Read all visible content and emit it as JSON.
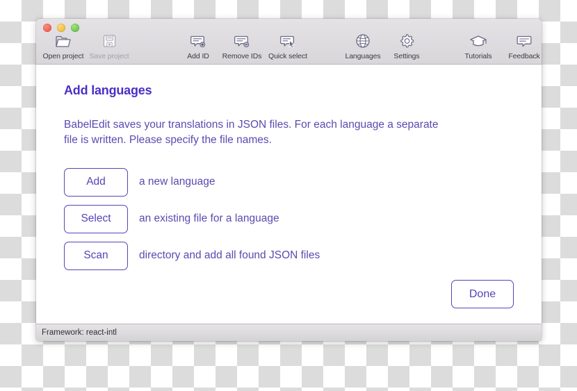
{
  "window": {
    "traffic_lights": [
      "close",
      "minimize",
      "zoom"
    ]
  },
  "toolbar": {
    "groups": [
      {
        "name": "file",
        "items": [
          {
            "label": "Open project",
            "icon": "folder-open-icon",
            "disabled": false
          },
          {
            "label": "Save project",
            "icon": "floppy-disk-icon",
            "disabled": true
          }
        ]
      },
      {
        "name": "ids",
        "items": [
          {
            "label": "Add ID",
            "icon": "speech-bubble-plus-icon",
            "disabled": false
          },
          {
            "label": "Remove IDs",
            "icon": "speech-bubble-minus-icon",
            "disabled": false
          },
          {
            "label": "Quick select",
            "icon": "speech-bubble-cursor-icon",
            "disabled": false
          }
        ]
      },
      {
        "name": "config",
        "items": [
          {
            "label": "Languages",
            "icon": "globe-icon",
            "disabled": false
          },
          {
            "label": "Settings",
            "icon": "gear-icon",
            "disabled": false
          }
        ]
      },
      {
        "name": "help",
        "items": [
          {
            "label": "Tutorials",
            "icon": "graduation-cap-icon",
            "disabled": false
          },
          {
            "label": "Feedback",
            "icon": "speech-bubble-icon",
            "disabled": false
          }
        ]
      }
    ]
  },
  "main": {
    "title": "Add languages",
    "intro": "BabelEdit saves your translations in JSON files. For each language a separate file is written. Please specify the file names.",
    "actions": [
      {
        "button": "Add",
        "description": "a new language"
      },
      {
        "button": "Select",
        "description": "an existing file for a language"
      },
      {
        "button": "Scan",
        "description": "directory and add all found JSON files"
      }
    ],
    "done_label": "Done"
  },
  "status": {
    "text": "Framework: react-intl"
  },
  "colors": {
    "accent": "#5842b8",
    "heading": "#4b2fc7",
    "body_text": "#5a4ab0",
    "icon_stroke": "#6b6a86"
  }
}
